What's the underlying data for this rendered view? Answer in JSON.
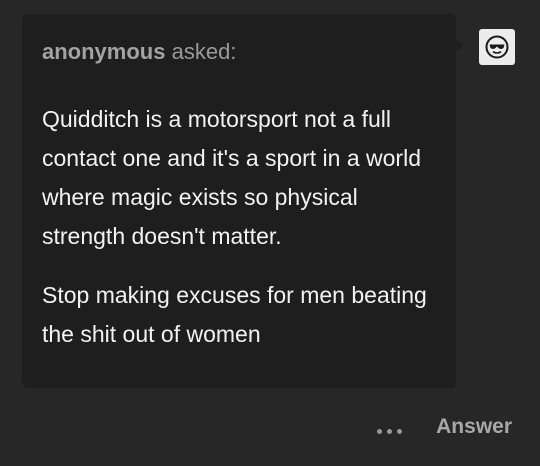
{
  "ask": {
    "asker_name": "anonymous",
    "asked_label": "asked:",
    "paragraphs": [
      "Quidditch is a motorsport not a full contact one and it's a sport in a world where magic exists so physical strength doesn't matter.",
      "Stop making excuses for men beating the shit out of women"
    ]
  },
  "avatar": {
    "icon": "sunglasses-face-icon"
  },
  "actions": {
    "more_icon": "ellipsis-icon",
    "answer_label": "Answer"
  },
  "colors": {
    "background": "#272727",
    "bubble": "#1e1e1e",
    "question_text": "#f2f2f2",
    "muted_text": "#9a9a9a"
  }
}
